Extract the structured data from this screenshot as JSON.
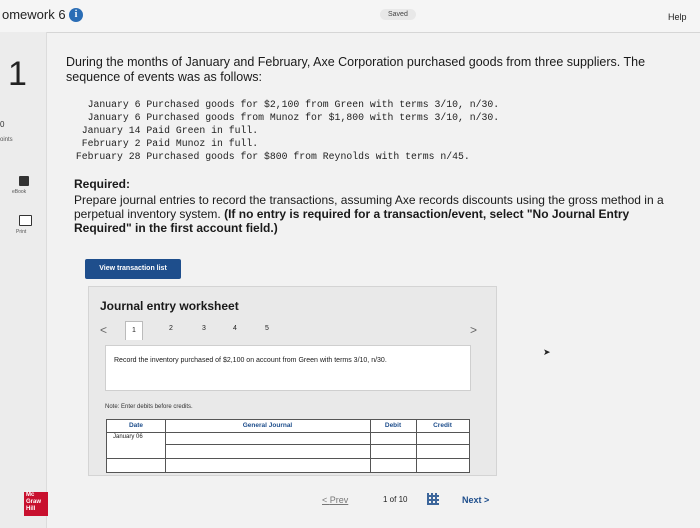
{
  "header": {
    "title": "omework 6",
    "saved": "Saved",
    "help": "Help"
  },
  "sidebar": {
    "question_number": "1",
    "points_value": "0",
    "points_label": "oints",
    "ebook": "eBook",
    "print": "Print",
    "logo": "Mc Graw Hill"
  },
  "question": {
    "intro": "During the months of January and February, Axe Corporation purchased goods from three suppliers. The sequence of events was as follows:",
    "events": [
      "   January 6 Purchased goods for $2,100 from Green with terms 3/10, n/30.",
      "   January 6 Purchased goods from Munoz for $1,800 with terms 3/10, n/30.",
      "  January 14 Paid Green in full.",
      "  February 2 Paid Munoz in full.",
      " February 28 Purchased goods for $800 from Reynolds with terms n/45."
    ],
    "required_heading": "Required:",
    "required_text": "Prepare journal entries to record the transactions, assuming Axe records discounts using the gross method in a perpetual inventory system.",
    "required_bold": "(If no entry is required for a transaction/event, select \"No Journal Entry Required\" in the first account field.)"
  },
  "view_button": "View transaction list",
  "worksheet": {
    "title": "Journal entry worksheet",
    "pages": [
      "1",
      "2",
      "3",
      "4",
      "5"
    ],
    "prev_arrow": "<",
    "next_arrow": ">",
    "description": "Record the inventory purchased of $2,100 on account from Green with terms 3/10, n/30.",
    "note": "Note: Enter debits before credits.",
    "columns": [
      "Date",
      "General Journal",
      "Debit",
      "Credit"
    ],
    "first_date": "January 06"
  },
  "pagination": {
    "prev": "Prev",
    "indicator": "1 of 10",
    "next": "Next"
  }
}
